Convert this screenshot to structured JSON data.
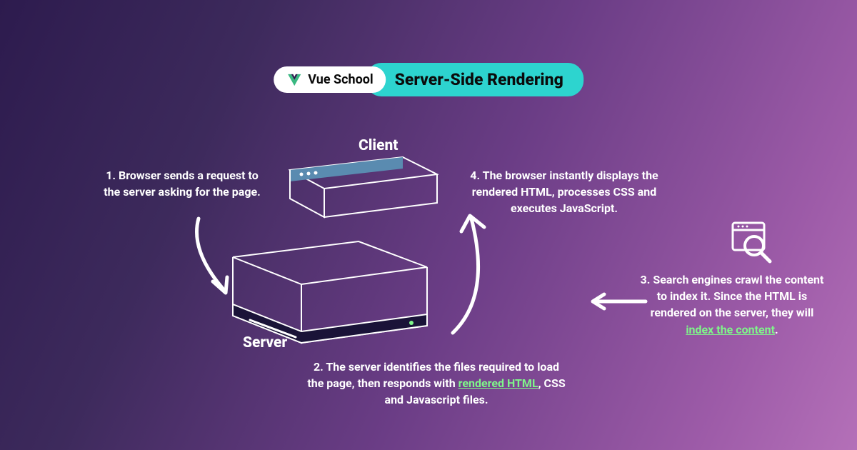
{
  "header": {
    "brand": "Vue School",
    "title": "Server-Side Rendering"
  },
  "labels": {
    "client": "Client",
    "server": "Server"
  },
  "steps": {
    "s1": "1. Browser sends a request to the server asking for the page.",
    "s2_pre": "2. The server identifies the files required to load the page, then responds with ",
    "s2_hl": "rendered HTML",
    "s2_post": ", CSS and Javascript files.",
    "s3_pre": "3. Search engines crawl the content to index it. Since the HTML is rendered on the server, they will ",
    "s3_hl": "index the content",
    "s3_post": ".",
    "s4": "4. The browser instantly displays the rendered HTML, processes CSS and executes JavaScript."
  },
  "colors": {
    "accent": "#2dd4cf",
    "highlight": "#7ff58a"
  }
}
